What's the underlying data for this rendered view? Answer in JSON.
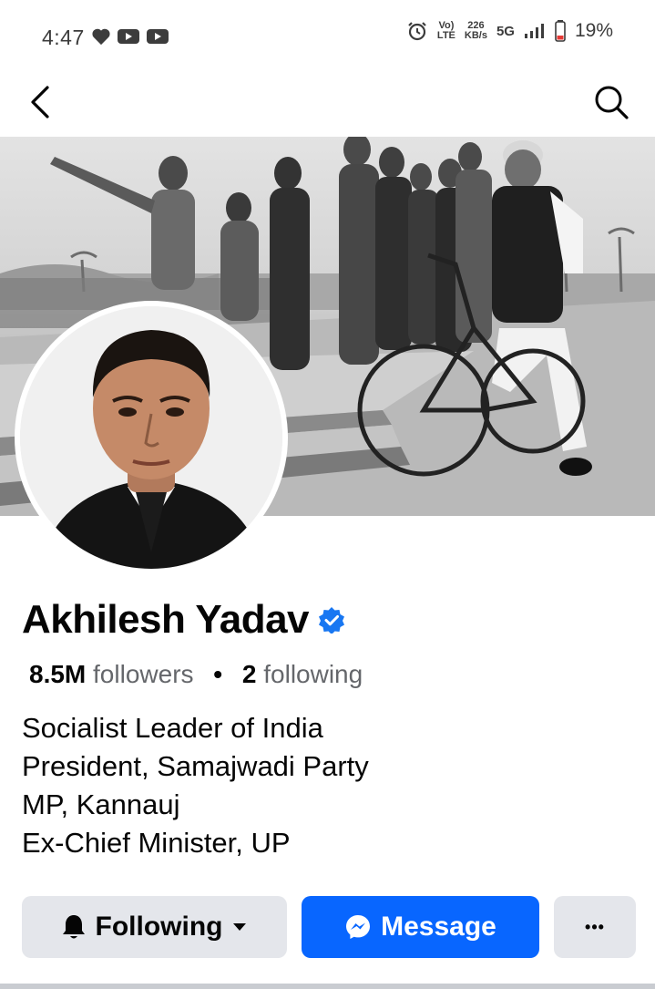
{
  "status_bar": {
    "time": "4:47",
    "network_top": "Vo)",
    "network_bottom": "LTE",
    "speed_top": "226",
    "speed_bottom": "KB/s",
    "network_type": "5G",
    "battery": "19%"
  },
  "profile": {
    "name": "Akhilesh Yadav",
    "followers_count": "8.5M",
    "followers_label": "followers",
    "separator": "•",
    "following_count": "2",
    "following_label": "following",
    "bio": [
      "Socialist Leader of India",
      "President, Samajwadi Party",
      "MP, Kannauj",
      "Ex-Chief Minister, UP"
    ]
  },
  "actions": {
    "following_label": "Following",
    "message_label": "Message",
    "more_label": "•••"
  },
  "colors": {
    "accent": "#0866ff",
    "button_gray": "#e4e6eb",
    "verified": "#1877f2",
    "battery_low": "#e53935"
  }
}
